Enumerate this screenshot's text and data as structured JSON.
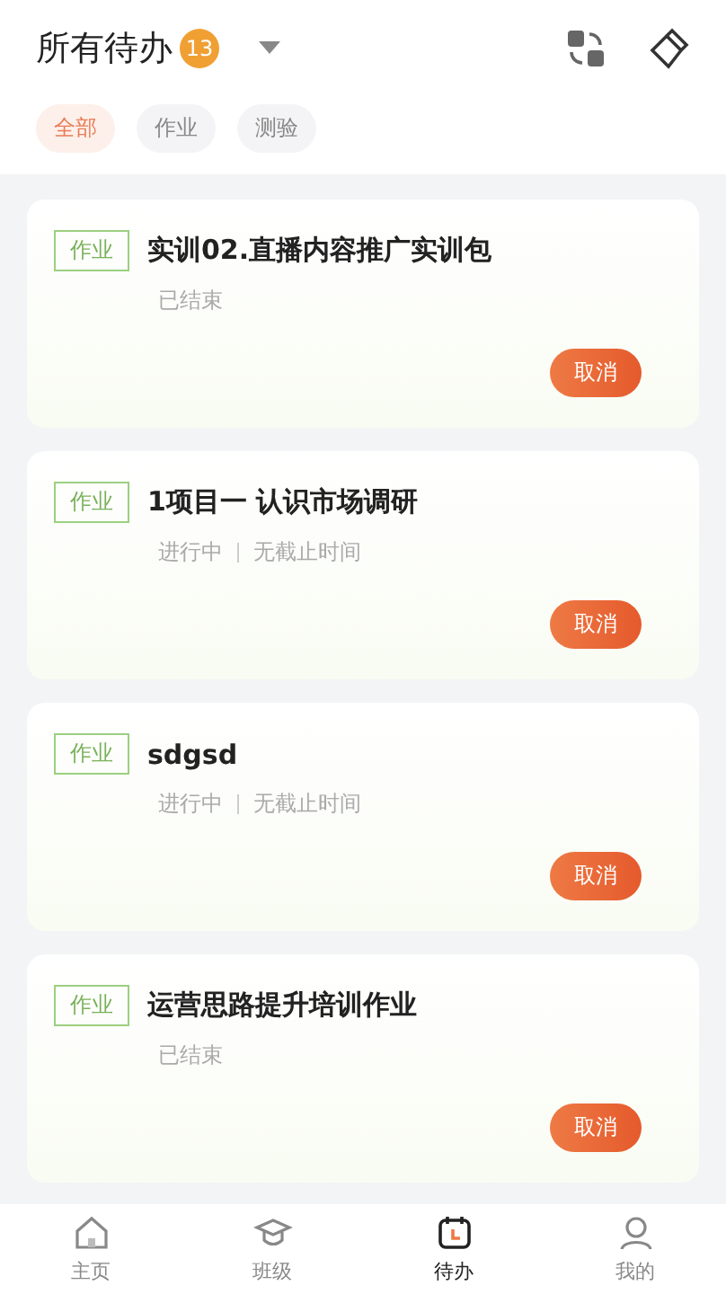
{
  "header": {
    "title": "所有待办",
    "count": "13"
  },
  "filters": [
    {
      "label": "全部",
      "selected": true
    },
    {
      "label": "作业",
      "selected": false
    },
    {
      "label": "测验",
      "selected": false
    }
  ],
  "tasks": [
    {
      "tag": "作业",
      "title": "实训02.直播内容推广实训包",
      "status": "已结束",
      "action": "取消"
    },
    {
      "tag": "作业",
      "title": "1项目一 认识市场调研",
      "status": "进行中",
      "deadline": "无截止时间",
      "action": "取消"
    },
    {
      "tag": "作业",
      "title": "sdgsd",
      "status": "进行中",
      "deadline": "无截止时间",
      "action": "取消"
    },
    {
      "tag": "作业",
      "title": "运营思路提升培训作业",
      "status": "已结束",
      "action": "取消"
    }
  ],
  "nav": [
    {
      "label": "主页",
      "selected": false
    },
    {
      "label": "班级",
      "selected": false
    },
    {
      "label": "待办",
      "selected": true
    },
    {
      "label": "我的",
      "selected": false
    }
  ]
}
